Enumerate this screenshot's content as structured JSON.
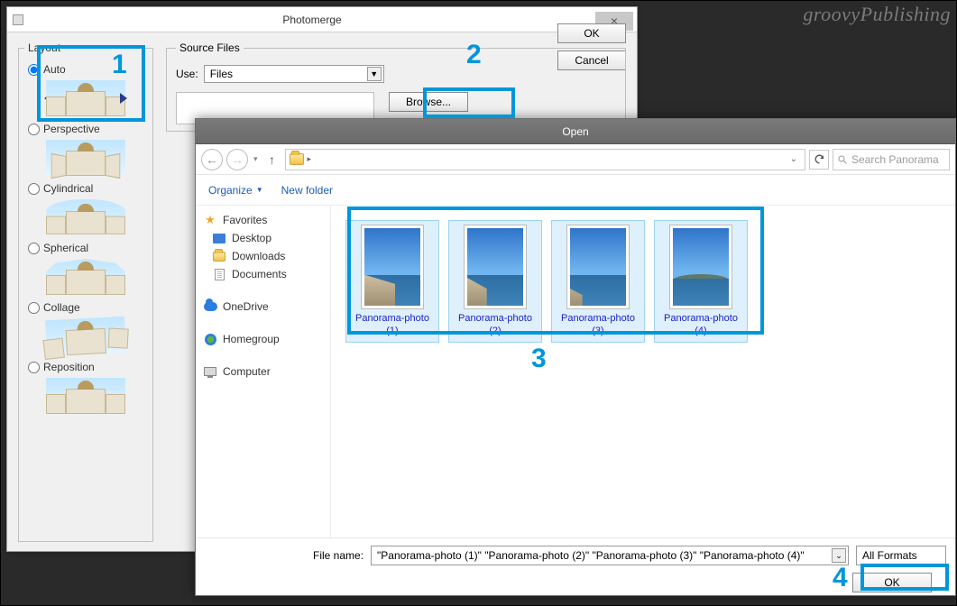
{
  "watermark": "groovyPublishing",
  "steps": {
    "s1": "1",
    "s2": "2",
    "s3": "3",
    "s4": "4"
  },
  "photomerge": {
    "title": "Photomerge",
    "close_glyph": "×",
    "ok": "OK",
    "cancel": "Cancel",
    "layout": {
      "legend": "Layout",
      "auto": "Auto",
      "perspective": "Perspective",
      "cylindrical": "Cylindrical",
      "spherical": "Spherical",
      "collage": "Collage",
      "reposition": "Reposition"
    },
    "source": {
      "legend": "Source Files",
      "use_label": "Use:",
      "use_value": "Files",
      "browse": "Browse..."
    }
  },
  "open": {
    "title": "Open",
    "nav": {
      "back": "←",
      "fwd": "→",
      "hist": "▾",
      "up": "↑",
      "chev": "▸",
      "dd": "⌄"
    },
    "search_placeholder": "Search Panorama",
    "organize": "Organize",
    "new_folder": "New folder",
    "sidebar": {
      "favorites": "Favorites",
      "desktop": "Desktop",
      "downloads": "Downloads",
      "documents": "Documents",
      "onedrive": "OneDrive",
      "homegroup": "Homegroup",
      "computer": "Computer"
    },
    "files": [
      {
        "name": "Panorama-photo",
        "num": "(1)"
      },
      {
        "name": "Panorama-photo",
        "num": "(2)"
      },
      {
        "name": "Panorama-photo",
        "num": "(3)"
      },
      {
        "name": "Panorama-photo",
        "num": "(4)"
      }
    ],
    "filename_label": "File name:",
    "filename_value": "\"Panorama-photo (1)\" \"Panorama-photo (2)\" \"Panorama-photo (3)\" \"Panorama-photo (4)\"",
    "format": "All Formats",
    "ok": "OK"
  }
}
